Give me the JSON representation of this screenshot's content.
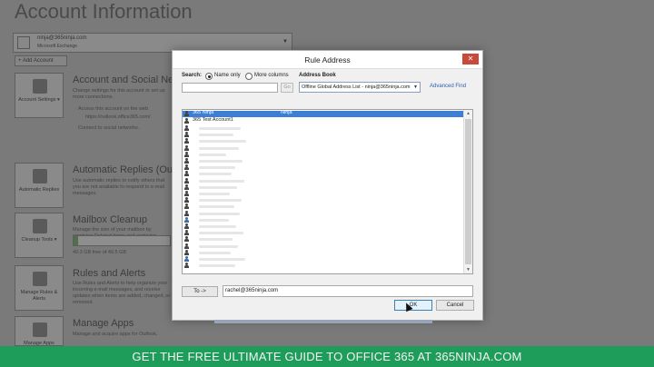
{
  "backstage": {
    "title": "Account Information",
    "account_email": "ninja@365ninja.com",
    "account_type": "Microsoft Exchange",
    "add_account": "+ Add Account",
    "sections": [
      {
        "tile": "Account Settings ▾",
        "title": "Account and Social Net",
        "desc": "Change settings for this account or set up more connections.",
        "bullets": [
          "Access this account on the web",
          "https://outlook.office365.com/",
          "Connect to social networks."
        ]
      },
      {
        "tile": "Automatic Replies",
        "title": "Automatic Replies (Out o",
        "desc": "Use automatic replies to notify others that you are not available to respond to e-mail messages."
      },
      {
        "tile": "Cleanup Tools ▾",
        "title": "Mailbox Cleanup",
        "desc": "Manage the size of your mailbox by emptying Deleted Items and archiving.",
        "storage": "49.3 GB free of 49.5 GB"
      },
      {
        "tile": "Manage Rules & Alerts",
        "title": "Rules and Alerts",
        "desc": "Use Rules and Alerts to help organize your incoming e-mail messages, and receive updates when items are added, changed, or removed."
      },
      {
        "tile": "Manage Apps",
        "title": "Manage Apps",
        "desc": "Manage and acquire apps for Outlook."
      }
    ],
    "storage_fraction": 0.05
  },
  "dialog": {
    "title": "Rule Address",
    "close": "✕",
    "search_label": "Search:",
    "radio_name_only": "Name only",
    "radio_more_columns": "More columns",
    "address_book_label": "Address Book",
    "search_value": "",
    "go": "Go",
    "address_book_value": "Offline Global Address List - ninja@365ninja.com",
    "advanced_find": "Advanced Find",
    "list": [
      {
        "name": "365 Ninja",
        "alias": "Ninja",
        "selected": true,
        "group": false
      },
      {
        "name": "365 Test Account1",
        "alias": "",
        "selected": false,
        "group": false
      }
    ],
    "to_button": "To ->",
    "to_value": "rachel@365ninja.com",
    "ok": "OK",
    "cancel": "Cancel"
  },
  "banner": {
    "text": "GET THE FREE ULTIMATE GUIDE TO OFFICE 365 AT 365NINJA.COM"
  },
  "colors": {
    "banner": "#1e9c5a",
    "selection": "#3d7fd4",
    "close": "#c94a3b",
    "link": "#3060b0"
  }
}
